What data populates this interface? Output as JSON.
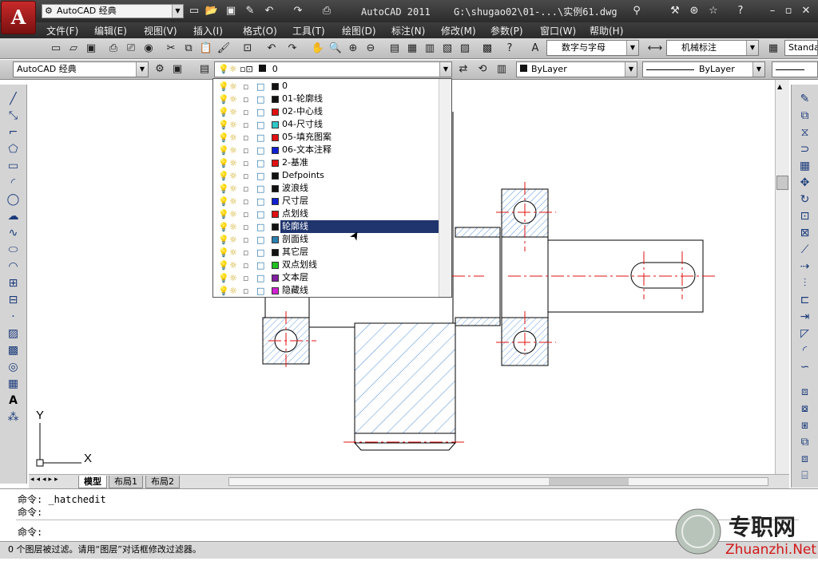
{
  "titlebar": {
    "workspace": "AutoCAD 经典",
    "app_title": "AutoCAD 2011",
    "file_path": "G:\\shugao02\\01-...\\实例61.dwg"
  },
  "menu": [
    "文件(F)",
    "编辑(E)",
    "视图(V)",
    "插入(I)",
    "格式(O)",
    "工具(T)",
    "绘图(D)",
    "标注(N)",
    "修改(M)",
    "参数(P)",
    "窗口(W)",
    "帮助(H)"
  ],
  "toolbar2": {
    "text_style": "数字与字母",
    "dim_style": "机械标注",
    "table_style": "Standa"
  },
  "toolbar3": {
    "workspace": "AutoCAD 经典",
    "current_layer": "0",
    "color": "ByLayer",
    "linetype": "ByLayer"
  },
  "layers": [
    {
      "name": "0",
      "color": "#111111"
    },
    {
      "name": "01-轮廓线",
      "color": "#111111"
    },
    {
      "name": "02-中心线",
      "color": "#e01010"
    },
    {
      "name": "04-尺寸线",
      "color": "#30c8c8"
    },
    {
      "name": "05-填充图案",
      "color": "#e01010"
    },
    {
      "name": "06-文本注释",
      "color": "#1020d0"
    },
    {
      "name": "2-基准",
      "color": "#e01010"
    },
    {
      "name": "Defpoints",
      "color": "#111111"
    },
    {
      "name": "波浪线",
      "color": "#111111"
    },
    {
      "name": "尺寸层",
      "color": "#1020d0"
    },
    {
      "name": "点划线",
      "color": "#e01010"
    },
    {
      "name": "轮廓线",
      "color": "#111111",
      "selected": true
    },
    {
      "name": "剖面线",
      "color": "#2a7fb0"
    },
    {
      "name": "其它层",
      "color": "#111111"
    },
    {
      "name": "双点划线",
      "color": "#20c020"
    },
    {
      "name": "文本层",
      "color": "#8020a0"
    },
    {
      "name": "隐藏线",
      "color": "#d020d0"
    }
  ],
  "tabs": {
    "model": "模型",
    "layout1": "布局1",
    "layout2": "布局2"
  },
  "ucs": {
    "y": "Y",
    "x": "X"
  },
  "command": {
    "line1": "命令: _hatchedit",
    "line2": "命令:",
    "prompt": "命令:"
  },
  "status": "0 个图层被过滤。请用“图层”对话框修改过滤器。",
  "watermark": {
    "cn": "专职网",
    "en": "Zhuanzhi.Net"
  }
}
